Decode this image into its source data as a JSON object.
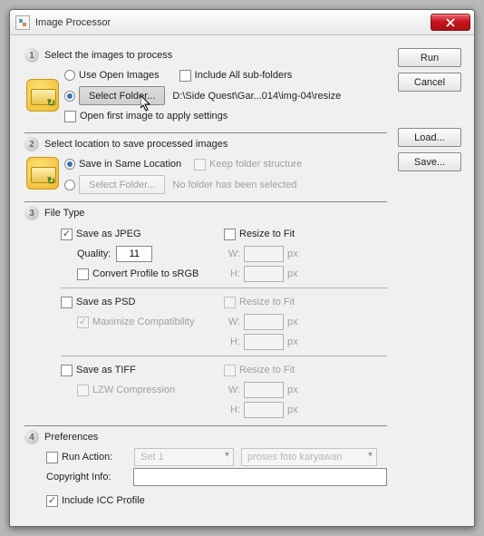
{
  "window": {
    "title": "Image Processor"
  },
  "buttons": {
    "run": "Run",
    "cancel": "Cancel",
    "load": "Load...",
    "save": "Save...",
    "select_folder": "Select Folder..."
  },
  "section1": {
    "title": "Select the images to process",
    "use_open_images": "Use Open Images",
    "include_subfolders": "Include All sub-folders",
    "selected_path": "D:\\Side Quest\\Gar...014\\img-04\\resize",
    "open_first_image": "Open first image to apply settings"
  },
  "section2": {
    "title": "Select location to save processed images",
    "save_same": "Save in Same Location",
    "keep_structure": "Keep folder structure",
    "no_folder": "No folder has been selected"
  },
  "section3": {
    "title": "File Type",
    "save_jpeg": "Save as JPEG",
    "resize_fit": "Resize to Fit",
    "quality": "Quality:",
    "quality_value": "11",
    "convert_srgb": "Convert Profile to sRGB",
    "save_psd": "Save as PSD",
    "max_compat": "Maximize Compatibility",
    "save_tiff": "Save as TIFF",
    "lzw": "LZW Compression",
    "w": "W:",
    "h": "H:",
    "px": "px"
  },
  "section4": {
    "title": "Preferences",
    "run_action": "Run Action:",
    "action_set": "Set 1",
    "action_name": "proses foto karyawan",
    "copyright_info": "Copyright Info:",
    "copyright_value": "",
    "include_icc": "Include ICC Profile"
  }
}
